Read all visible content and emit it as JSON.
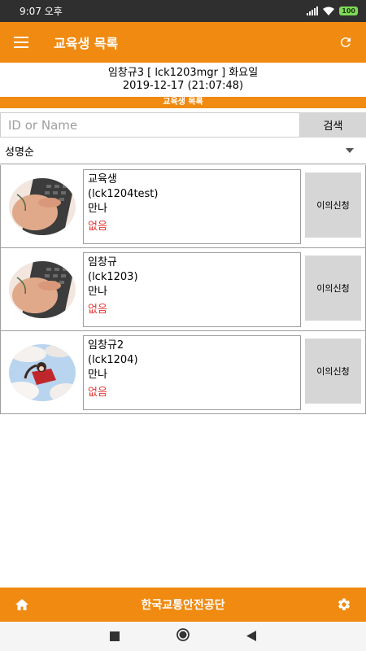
{
  "status_bar": {
    "time": "9:07 오후",
    "battery": "100"
  },
  "app_bar": {
    "title": "교육생 목록"
  },
  "info": {
    "line1": "임창규3 [ lck1203mgr ] 화요일",
    "line2": "2019-12-17 (21:07:48)"
  },
  "section_title": "교육생 목록",
  "search": {
    "placeholder": "ID or Name",
    "value": "",
    "button": "검색"
  },
  "sort": {
    "selected": "성명순"
  },
  "students": [
    {
      "name": "교육생",
      "id": "(lck1204test)",
      "status": "만나",
      "result": "없음",
      "action": "이의신청",
      "avatar": "hand-on-keyboard-photo"
    },
    {
      "name": "임창규",
      "id": "(lck1203)",
      "status": "만나",
      "result": "없음",
      "action": "이의신청",
      "avatar": "hand-on-keyboard-photo"
    },
    {
      "name": "임창규2",
      "id": "(lck1204)",
      "status": "만나",
      "result": "없음",
      "action": "이의신청",
      "avatar": "anime-girl-sky-photo"
    }
  ],
  "bottom_bar": {
    "org": "한국교통안전공단"
  },
  "colors": {
    "accent": "#f08a10",
    "error": "#e53935",
    "button": "#d6d6d6"
  }
}
